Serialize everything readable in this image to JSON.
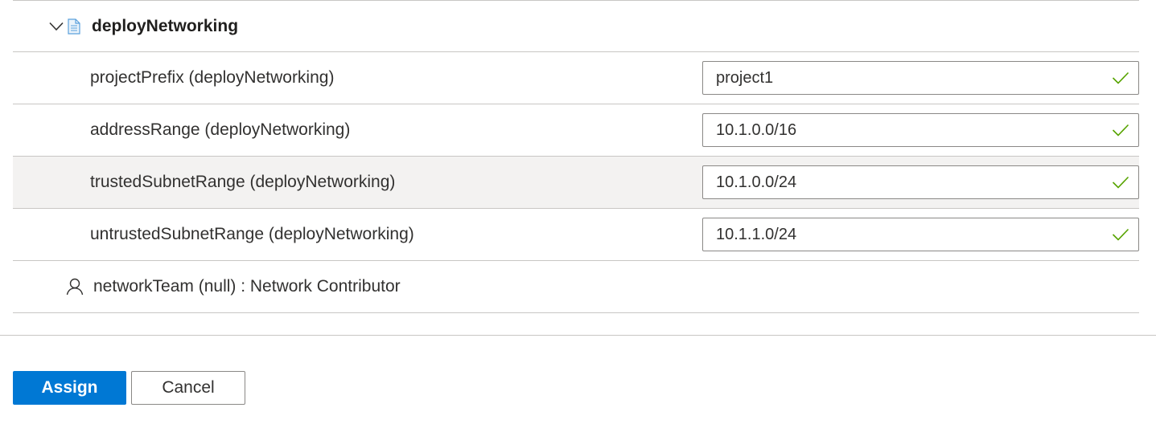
{
  "artifact": {
    "title": "deployNetworking",
    "expand_icon": "chevron-down-icon",
    "type_icon": "document-icon"
  },
  "parameters": [
    {
      "label": "projectPrefix (deployNetworking)",
      "value": "project1",
      "valid": true
    },
    {
      "label": "addressRange (deployNetworking)",
      "value": "10.1.0.0/16",
      "valid": true
    },
    {
      "label": "trustedSubnetRange (deployNetworking)",
      "value": "10.1.0.0/24",
      "valid": true
    },
    {
      "label": "untrustedSubnetRange (deployNetworking)",
      "value": "10.1.1.0/24",
      "valid": true
    }
  ],
  "role": {
    "icon": "person-icon",
    "label": "networkTeam (null) : Network Contributor"
  },
  "footer": {
    "assign_label": "Assign",
    "cancel_label": "Cancel"
  },
  "colors": {
    "accent": "#0078d4",
    "valid_check": "#57a300",
    "border": "#c8c6c4",
    "row_hover": "#f3f2f1"
  }
}
